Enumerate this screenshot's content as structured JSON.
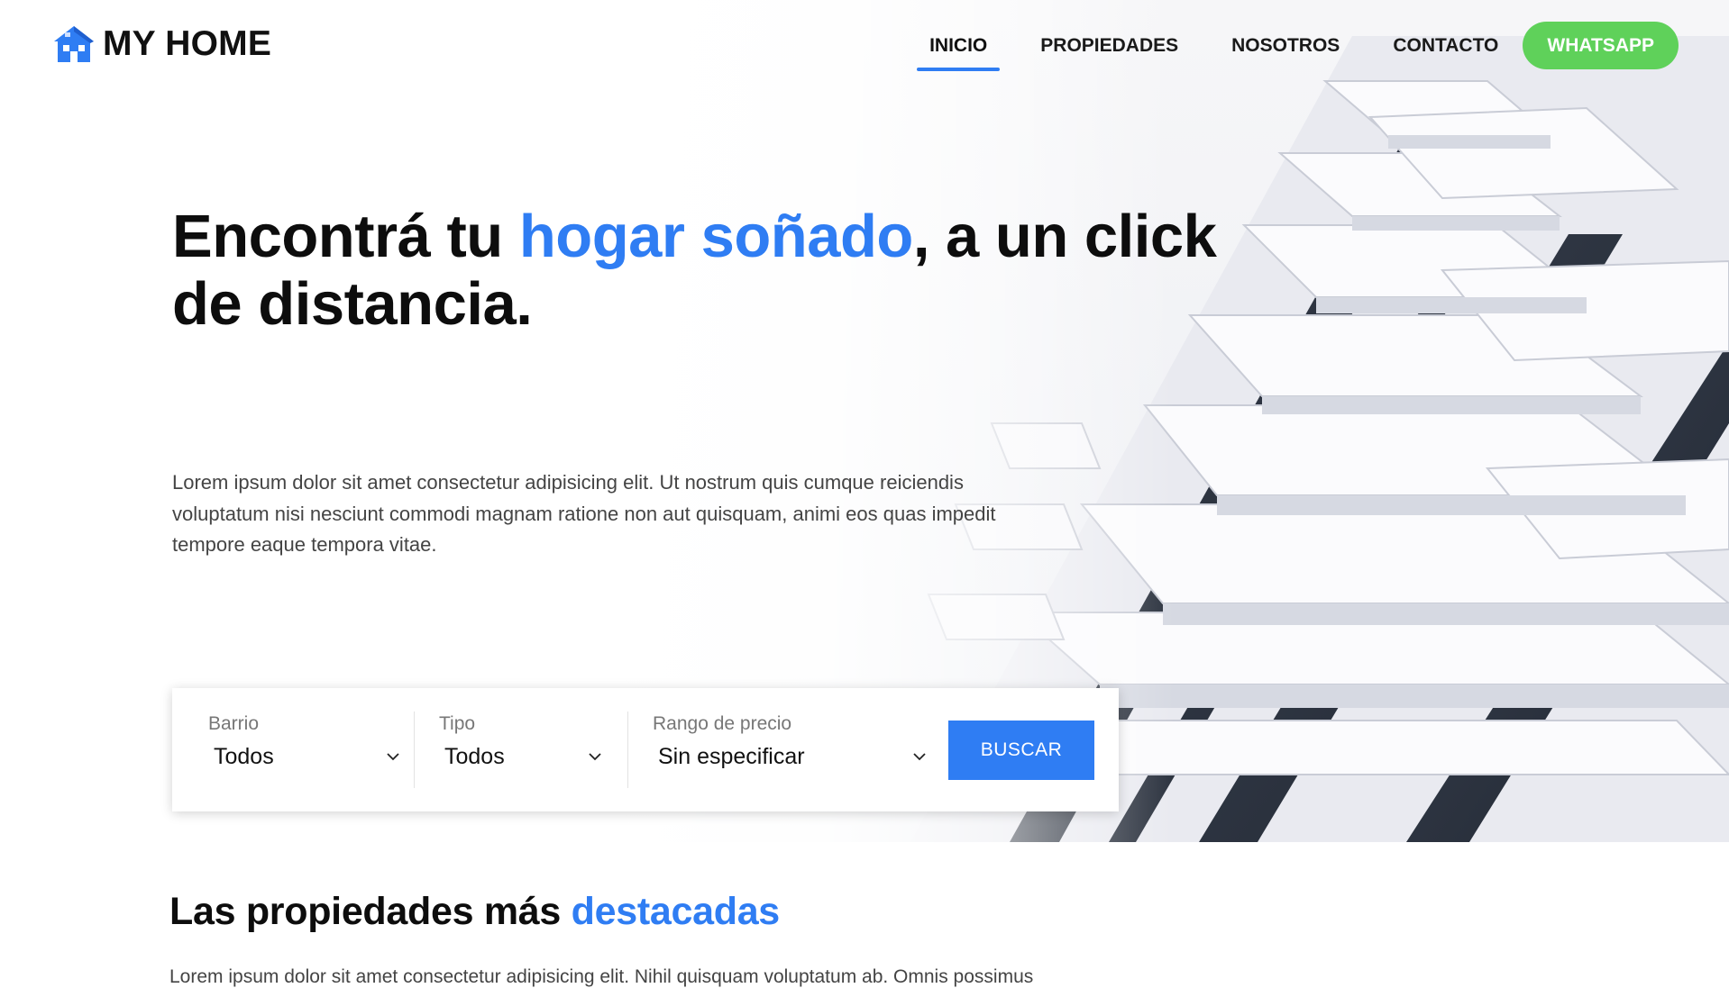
{
  "brand": {
    "name": "MY HOME",
    "icon": "house-icon"
  },
  "nav": {
    "items": [
      {
        "label": "INICIO",
        "active": true
      },
      {
        "label": "PROPIEDADES",
        "active": false
      },
      {
        "label": "NOSOTROS",
        "active": false
      },
      {
        "label": "CONTACTO",
        "active": false
      }
    ],
    "cta_label": "WHATSAPP"
  },
  "hero": {
    "headline_pre": "Encontrá tu ",
    "headline_accent": "hogar soñado",
    "headline_post": ", a un click de distancia.",
    "lead": "Lorem ipsum dolor sit amet consectetur adipisicing elit. Ut nostrum quis cumque reiciendis voluptatum nisi nesciunt commodi magnam ratione non aut quisquam, animi eos quas impedit tempore eaque tempora vitae."
  },
  "search": {
    "fields": [
      {
        "label": "Barrio",
        "value": "Todos"
      },
      {
        "label": "Tipo",
        "value": "Todos"
      },
      {
        "label": "Rango de precio",
        "value": "Sin especificar"
      }
    ],
    "submit_label": "BUSCAR"
  },
  "featured": {
    "title_pre": "Las propiedades más ",
    "title_accent": "destacadas",
    "text": "Lorem ipsum dolor sit amet consectetur adipisicing elit. Nihil quisquam voluptatum ab. Omnis possimus"
  },
  "colors": {
    "accent": "#2f7df3",
    "whatsapp": "#5fd15a",
    "text": "#111111"
  }
}
